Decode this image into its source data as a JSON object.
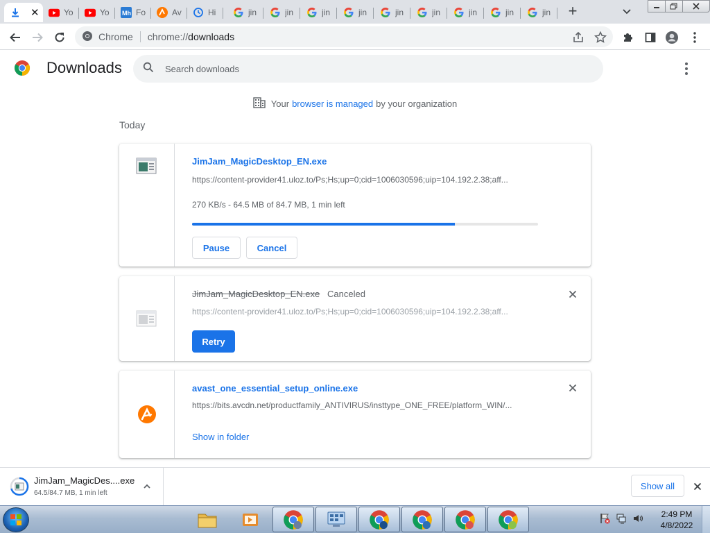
{
  "tabs": [
    {
      "title": "",
      "icon": "download-icon",
      "active": true
    },
    {
      "title": "Yo",
      "icon": "youtube-icon"
    },
    {
      "title": "Yo",
      "icon": "youtube-icon"
    },
    {
      "title": "Fo",
      "icon": "mh-icon"
    },
    {
      "title": "Av",
      "icon": "avast-icon"
    },
    {
      "title": "Hi",
      "icon": "history-icon"
    },
    {
      "title": "jin",
      "icon": "google-icon"
    },
    {
      "title": "jin",
      "icon": "google-icon"
    },
    {
      "title": "jin",
      "icon": "google-icon"
    },
    {
      "title": "jin",
      "icon": "google-icon"
    },
    {
      "title": "jin",
      "icon": "google-icon"
    },
    {
      "title": "jin",
      "icon": "google-icon"
    },
    {
      "title": "jin",
      "icon": "google-icon"
    },
    {
      "title": "jin",
      "icon": "google-icon"
    },
    {
      "title": "jin",
      "icon": "google-icon"
    }
  ],
  "omnibox": {
    "chip": "Chrome",
    "url_scheme": "chrome://",
    "url_host": "downloads"
  },
  "page": {
    "title": "Downloads",
    "search_placeholder": "Search downloads"
  },
  "managed_notice": {
    "prefix": "Your",
    "link": "browser is managed",
    "suffix": "by your organization"
  },
  "section_label": "Today",
  "downloads": [
    {
      "name": "JimJam_MagicDesktop_EN.exe",
      "url": "https://content-provider41.uloz.to/Ps;Hs;up=0;cid=1006030596;uip=104.192.2.38;aff...",
      "progress_text": "270 KB/s - 64.5 MB of 84.7 MB, 1 min left",
      "progress": 0.76,
      "pause_label": "Pause",
      "cancel_label": "Cancel"
    },
    {
      "name": "JimJam_MagicDesktop_EN.exe",
      "status": "Canceled",
      "url": "https://content-provider41.uloz.to/Ps;Hs;up=0;cid=1006030596;uip=104.192.2.38;aff...",
      "retry_label": "Retry"
    },
    {
      "name": "avast_one_essential_setup_online.exe",
      "url": "https://bits.avcdn.net/productfamily_ANTIVIRUS/insttype_ONE_FREE/platform_WIN/...",
      "show_in_folder_label": "Show in folder"
    }
  ],
  "shelf": {
    "name": "JimJam_MagicDes....exe",
    "status": "64.5/84.7 MB, 1 min left",
    "show_all_label": "Show all"
  },
  "taskbar": {
    "time": "2:49 PM",
    "date": "4/8/2022"
  },
  "colors": {
    "accent": "#1a73e8",
    "tabstrip": "#dee1e6",
    "avast": "#ff7800"
  }
}
